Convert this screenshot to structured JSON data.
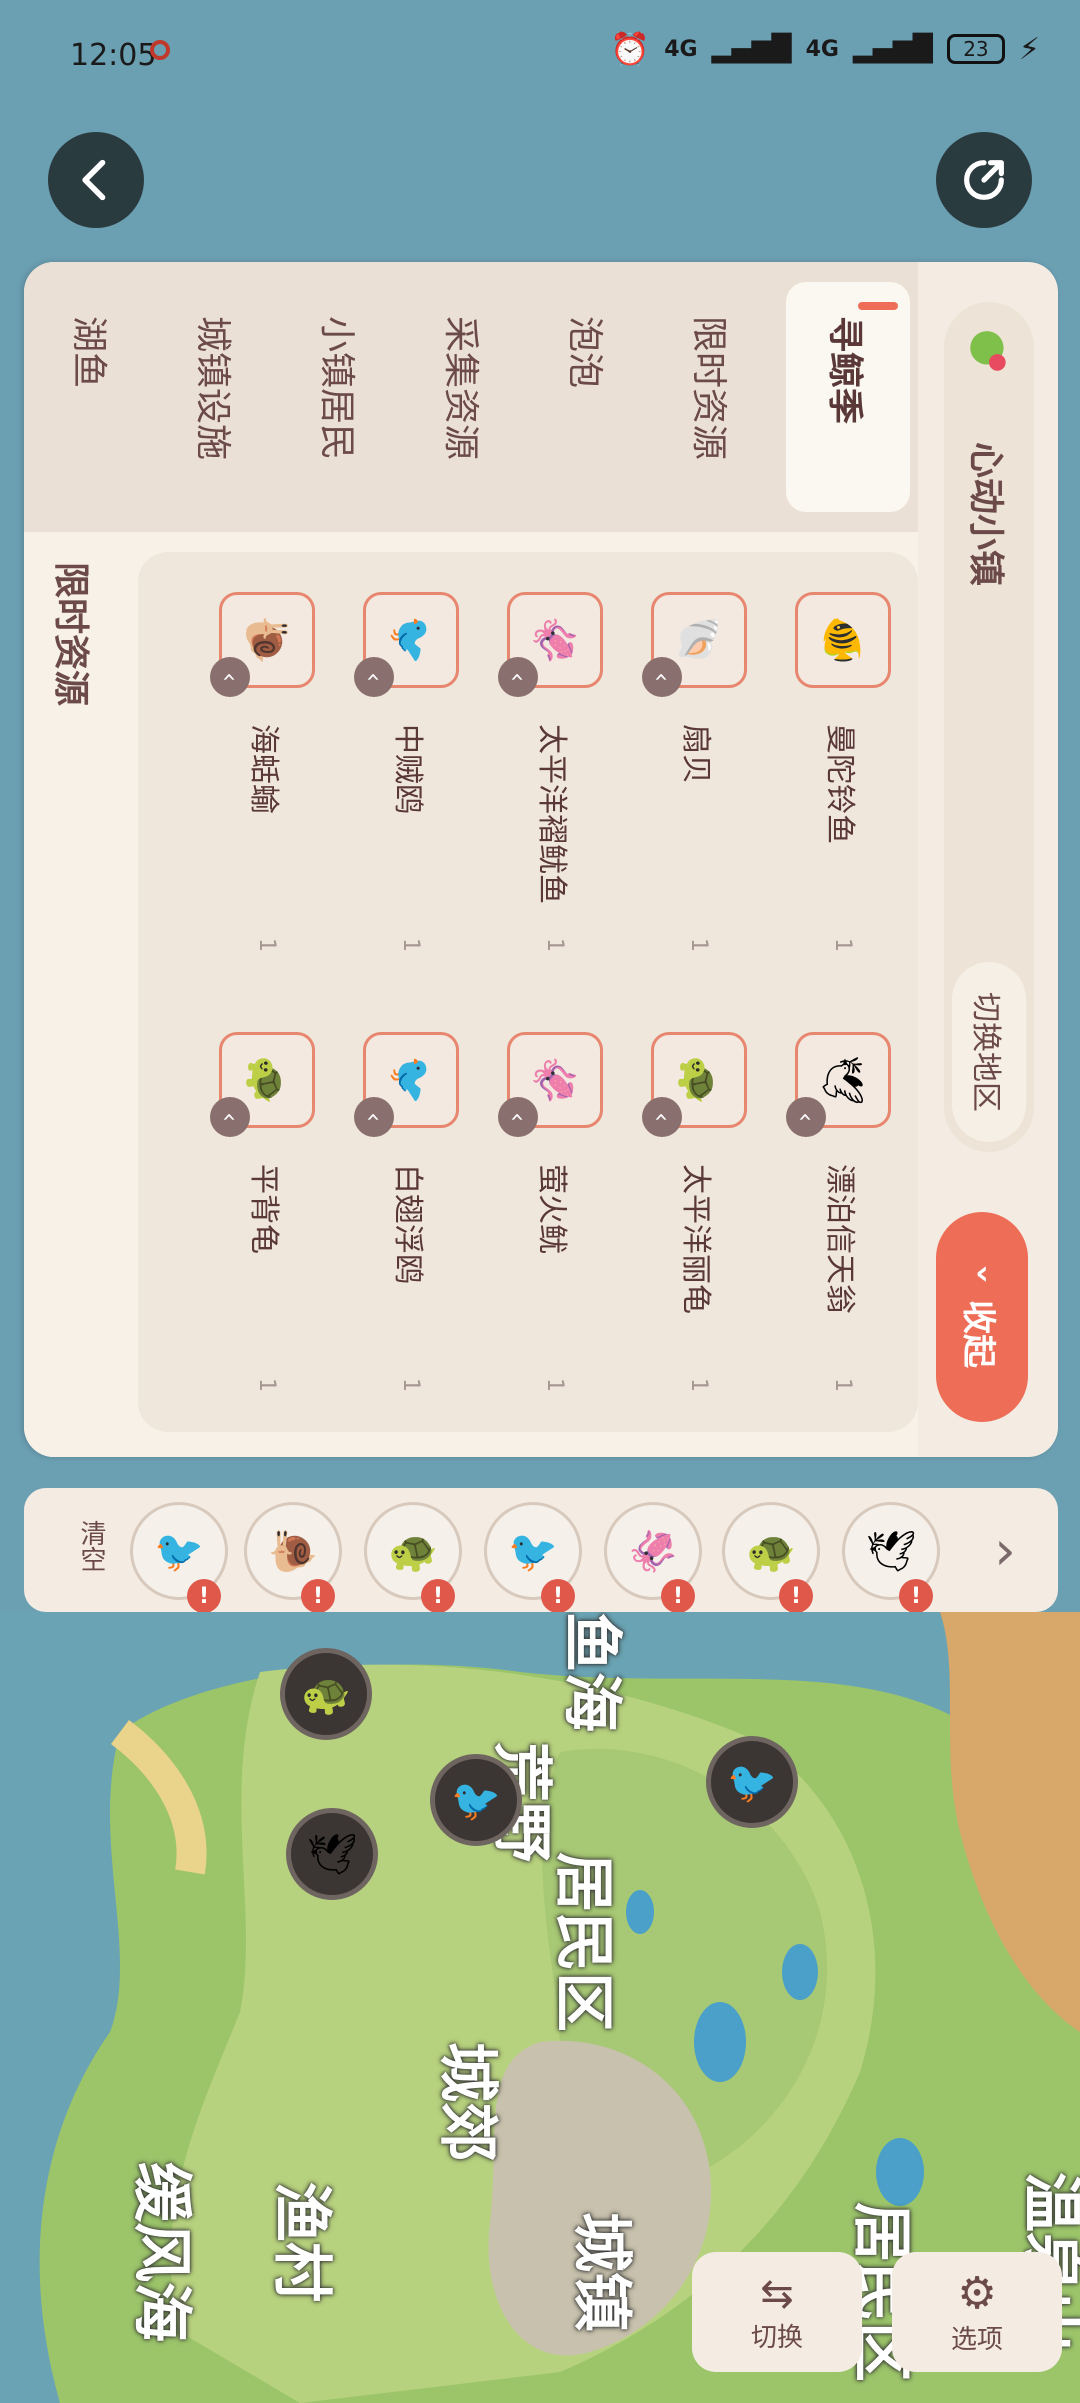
{
  "status_bar": {
    "time": "12:05",
    "signal1": "4G",
    "signal2": "4G",
    "battery": "23"
  },
  "panel": {
    "town_name": "心动小镇",
    "switch_region": "切换地区",
    "collapse": "收起",
    "tabs": [
      "寻鲸季",
      "限时资源",
      "泡泡",
      "采集资源",
      "小镇居民",
      "城镇设施",
      "湖鱼"
    ],
    "section_title": "限时资源",
    "items_left": [
      {
        "name": "曼陀铃鱼",
        "count": "1",
        "icon": "🐠"
      },
      {
        "name": "扇贝",
        "count": "1",
        "icon": "🐚"
      },
      {
        "name": "太平洋褶鱿鱼",
        "count": "1",
        "icon": "🦑"
      },
      {
        "name": "中贼鸥",
        "count": "1",
        "icon": "🐦"
      },
      {
        "name": "海蛞蝓",
        "count": "1",
        "icon": "🐌"
      }
    ],
    "items_right": [
      {
        "name": "漂泊信天翁",
        "count": "1",
        "icon": "🕊"
      },
      {
        "name": "太平洋丽龟",
        "count": "1",
        "icon": "🐢"
      },
      {
        "name": "萤火鱿",
        "count": "1",
        "icon": "🦑"
      },
      {
        "name": "白翅浮鸥",
        "count": "1",
        "icon": "🐦"
      },
      {
        "name": "平背龟",
        "count": "1",
        "icon": "🐢"
      }
    ]
  },
  "tracker": {
    "clear": "清空",
    "next": "›",
    "bubbles": [
      "🐦",
      "🐌",
      "🐢",
      "🐦",
      "🦑",
      "🐢",
      "🕊"
    ],
    "alert": "!"
  },
  "map": {
    "labels": [
      "鱼海",
      "荒野",
      "居民区",
      "城郊",
      "城镇",
      "渔村",
      "缓风海",
      "居民区",
      "温泉山"
    ],
    "switch_label": "切换",
    "options_label": "选项"
  }
}
